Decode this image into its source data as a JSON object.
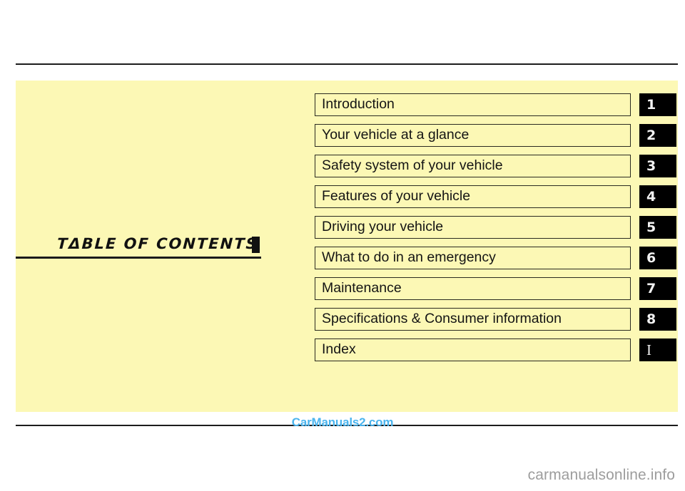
{
  "page": {
    "heading": "TΔBLE  OF  CONTENTS",
    "panel_color": "#fcf8b5",
    "rule_color": "#1c1c1c"
  },
  "contents": {
    "rows": [
      {
        "label": "Introduction",
        "badge": "1"
      },
      {
        "label": "Your vehicle at a glance",
        "badge": "2"
      },
      {
        "label": "Safety system of your vehicle",
        "badge": "3"
      },
      {
        "label": "Features of your vehicle",
        "badge": "4"
      },
      {
        "label": "Driving your vehicle",
        "badge": "5"
      },
      {
        "label": "What to do in an emergency",
        "badge": "6"
      },
      {
        "label": "Maintenance",
        "badge": "7"
      },
      {
        "label": "Specifications & Consumer information",
        "badge": "8"
      },
      {
        "label": "Index",
        "badge": "I"
      }
    ]
  },
  "watermarks": {
    "center": "CarManuals2.com",
    "center_color": "#4ab4ee",
    "corner": "carmanualsonline.info",
    "corner_color": "#9d9d9d"
  }
}
